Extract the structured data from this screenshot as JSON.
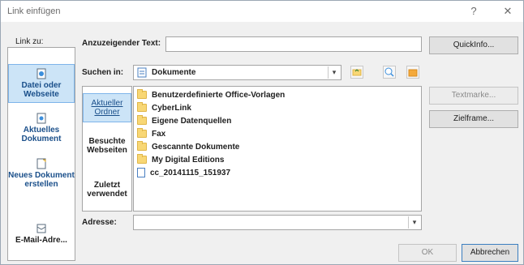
{
  "window": {
    "title": "Link einfügen",
    "help_glyph": "?",
    "close_glyph": "✕"
  },
  "link_to": {
    "label": "Link zu:"
  },
  "sidebar": {
    "items": [
      {
        "label": "Datei oder Webseite",
        "icon": "globe-document-icon",
        "active": true
      },
      {
        "label": "Aktuelles Dokument",
        "icon": "document-icon",
        "active": false
      },
      {
        "label": "Neues Dokument erstellen",
        "icon": "new-document-icon",
        "active": false
      },
      {
        "label": "E-Mail-Adre...",
        "icon": "email-icon",
        "active": false
      }
    ]
  },
  "display_text": {
    "label": "Anzuzeigender Text:",
    "value": ""
  },
  "quickinfo_button": "QuickInfo...",
  "look_in": {
    "label": "Suchen in:",
    "value": "Dokumente"
  },
  "inner_nav": {
    "items": [
      {
        "label": "Aktueller Ordner",
        "active": true
      },
      {
        "label": "Besuchte Webseiten",
        "active": false
      },
      {
        "label": "Zuletzt verwendet",
        "active": false
      }
    ]
  },
  "files": [
    {
      "name": "Benutzerdefinierte Office-Vorlagen",
      "type": "folder"
    },
    {
      "name": "CyberLink",
      "type": "folder"
    },
    {
      "name": "Eigene Datenquellen",
      "type": "folder"
    },
    {
      "name": "Fax",
      "type": "folder"
    },
    {
      "name": "Gescannte Dokumente",
      "type": "folder"
    },
    {
      "name": "My Digital Editions",
      "type": "folder"
    },
    {
      "name": "cc_20141115_151937",
      "type": "document"
    }
  ],
  "bookmark_button": "Textmarke...",
  "target_frame_button": "Zielframe...",
  "address": {
    "label": "Adresse:",
    "value": ""
  },
  "ok_button": "OK",
  "cancel_button": "Abbrechen",
  "colors": {
    "accent": "#cce4f7",
    "border": "#a5a5a5",
    "folder": "#f8d775"
  }
}
